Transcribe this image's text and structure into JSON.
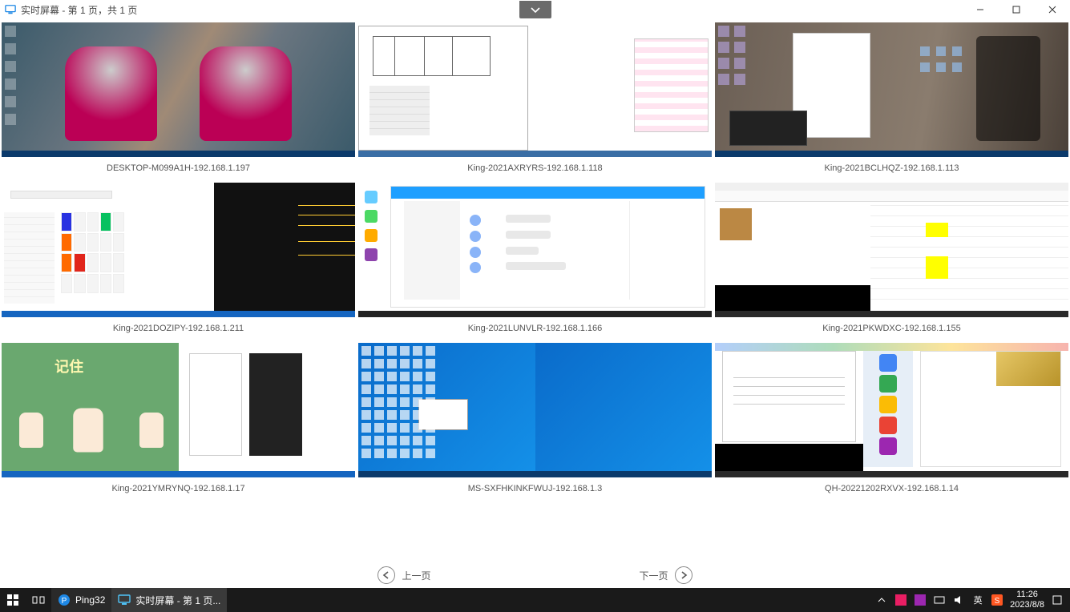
{
  "window": {
    "title": "实时屏幕 - 第 1 页，共 1 页",
    "collapse_glyph": "⌄"
  },
  "screens": [
    {
      "label": "DESKTOP-M099A1H-192.168.1.197",
      "variant": "ultra"
    },
    {
      "label": "King-2021AXRYRS-192.168.1.118",
      "variant": "cad"
    },
    {
      "label": "King-2021BCLHQZ-192.168.1.113",
      "variant": "samurai"
    },
    {
      "label": "King-2021DOZIPY-192.168.1.211",
      "variant": "browser"
    },
    {
      "label": "King-2021LUNVLR-192.168.1.166",
      "variant": "chat"
    },
    {
      "label": "King-2021PKWDXC-192.168.1.155",
      "variant": "sheet"
    },
    {
      "label": "King-2021YMRYNQ-192.168.1.17",
      "variant": "cartoon"
    },
    {
      "label": "MS-SXFHKINKFWUJ-192.168.1.3",
      "variant": "win10"
    },
    {
      "label": "QH-20221202RXVX-192.168.1.14",
      "variant": "office"
    }
  ],
  "pager": {
    "prev": "上一页",
    "next": "下一页"
  },
  "cartoon_title": "记住",
  "taskbar": {
    "app1": "Ping32",
    "app2": "实时屏幕 - 第 1 页...",
    "ime": "英",
    "time": "11:26",
    "date": "2023/8/8"
  }
}
